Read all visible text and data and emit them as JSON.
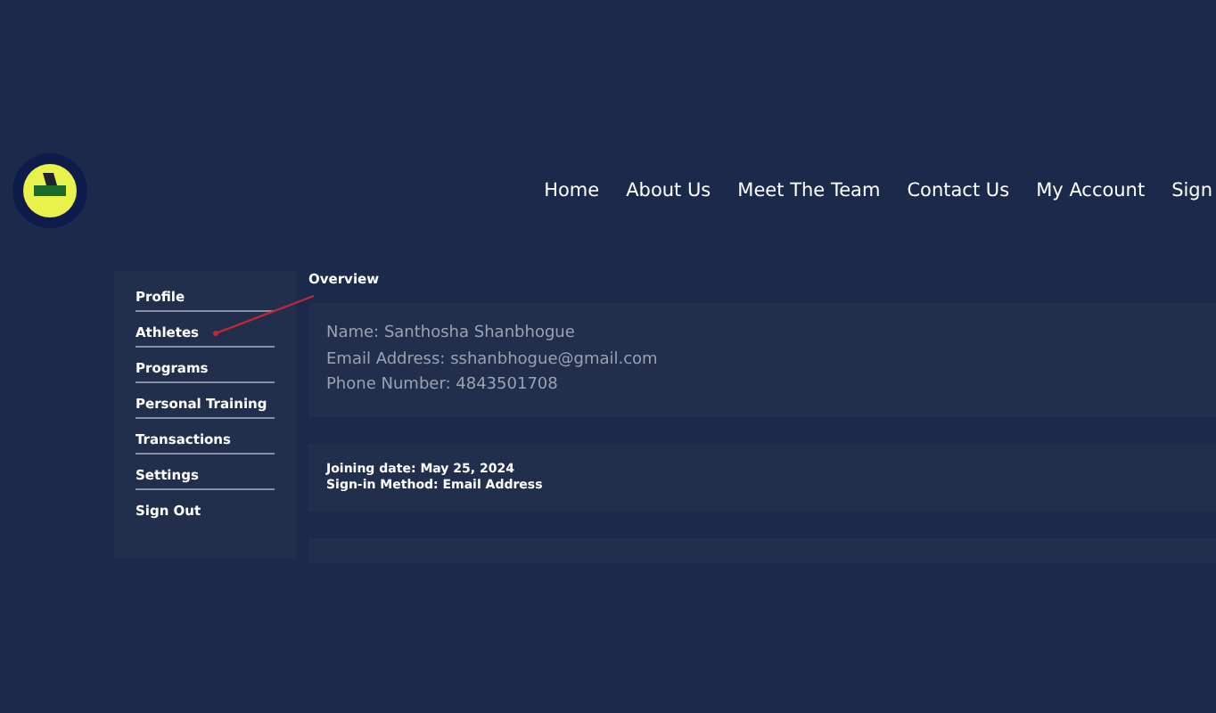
{
  "nav": {
    "items": [
      {
        "label": "Home"
      },
      {
        "label": "About Us"
      },
      {
        "label": "Meet The Team"
      },
      {
        "label": "Contact Us"
      },
      {
        "label": "My Account"
      },
      {
        "label": "Sign"
      }
    ]
  },
  "sidebar": {
    "items": [
      {
        "label": "Profile"
      },
      {
        "label": "Athletes"
      },
      {
        "label": "Programs"
      },
      {
        "label": "Personal Training"
      },
      {
        "label": "Transactions"
      },
      {
        "label": "Settings"
      },
      {
        "label": "Sign Out"
      }
    ]
  },
  "overview": {
    "title": "Overview",
    "contact_lines": [
      "Name: Santhosha Shanbhogue",
      "Email Address: sshanbhogue@gmail.com",
      "Phone Number: 4843501708"
    ],
    "account_lines": [
      "Joining date: May 25, 2024",
      "Sign-in Method: Email Address"
    ]
  }
}
